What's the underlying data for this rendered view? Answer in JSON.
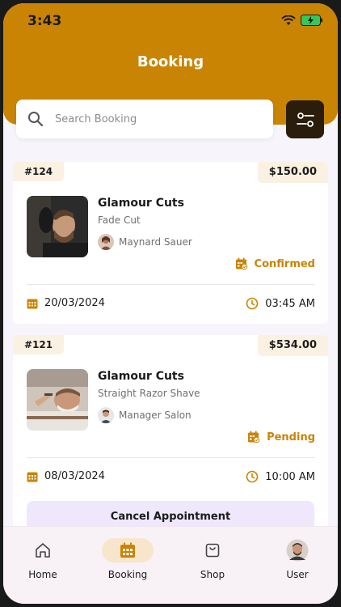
{
  "status_bar": {
    "time": "3:43"
  },
  "header": {
    "title": "Booking"
  },
  "search": {
    "placeholder": "Search Booking"
  },
  "bookings": [
    {
      "id": "#124",
      "price": "$150.00",
      "salon": "Glamour Cuts",
      "service": "Fade Cut",
      "person": "Maynard Sauer",
      "status": "Confirmed",
      "date": "20/03/2024",
      "time": "03:45 AM"
    },
    {
      "id": "#121",
      "price": "$534.00",
      "salon": "Glamour Cuts",
      "service": "Straight Razor Shave",
      "person": "Manager Salon",
      "status": "Pending",
      "date": "08/03/2024",
      "time": "10:00 AM",
      "action": "Cancel Appointment"
    }
  ],
  "tabs": [
    {
      "label": "Home",
      "icon": "home-icon"
    },
    {
      "label": "Booking",
      "icon": "calendar-icon",
      "active": true
    },
    {
      "label": "Shop",
      "icon": "bag-icon"
    },
    {
      "label": "User",
      "icon": "avatar"
    }
  ],
  "colors": {
    "accent": "#c98404",
    "badge_bg": "#fbf1e2",
    "filter_bg": "#2a1d0c",
    "cancel_bg": "#efe7fb"
  }
}
